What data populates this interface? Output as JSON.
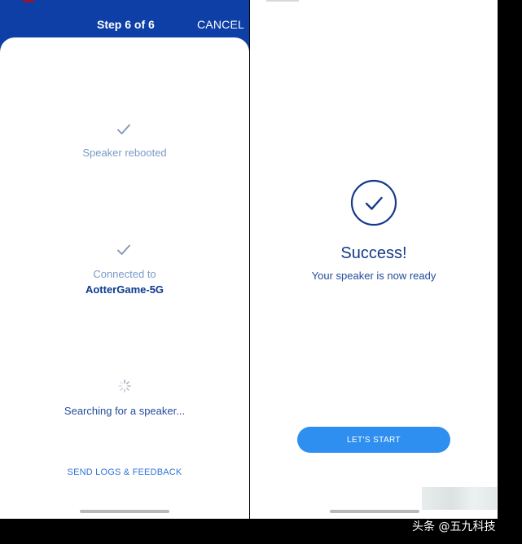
{
  "left": {
    "header": {
      "step": "Step 6 of 6",
      "cancel": "CANCEL"
    },
    "steps": [
      {
        "label": "Speaker rebooted",
        "state": "done",
        "icon": "check-icon"
      },
      {
        "label": "Connected to",
        "detail": "AotterGame-5G",
        "state": "done",
        "icon": "check-icon"
      },
      {
        "label": "Searching for a speaker...",
        "state": "loading",
        "icon": "spinner-icon"
      }
    ],
    "footer_link": "SEND LOGS & FEEDBACK"
  },
  "right": {
    "icon": "check-circle-icon",
    "title": "Success!",
    "subtitle": "Your speaker is now ready",
    "button": "LET'S START"
  },
  "watermark": "头条 @五九科技",
  "colors": {
    "header_blue": "#0d3fa6",
    "accent_blue": "#2f8ff0",
    "text_dark_blue": "#153a8a",
    "muted_blue": "#7a9ac8"
  }
}
